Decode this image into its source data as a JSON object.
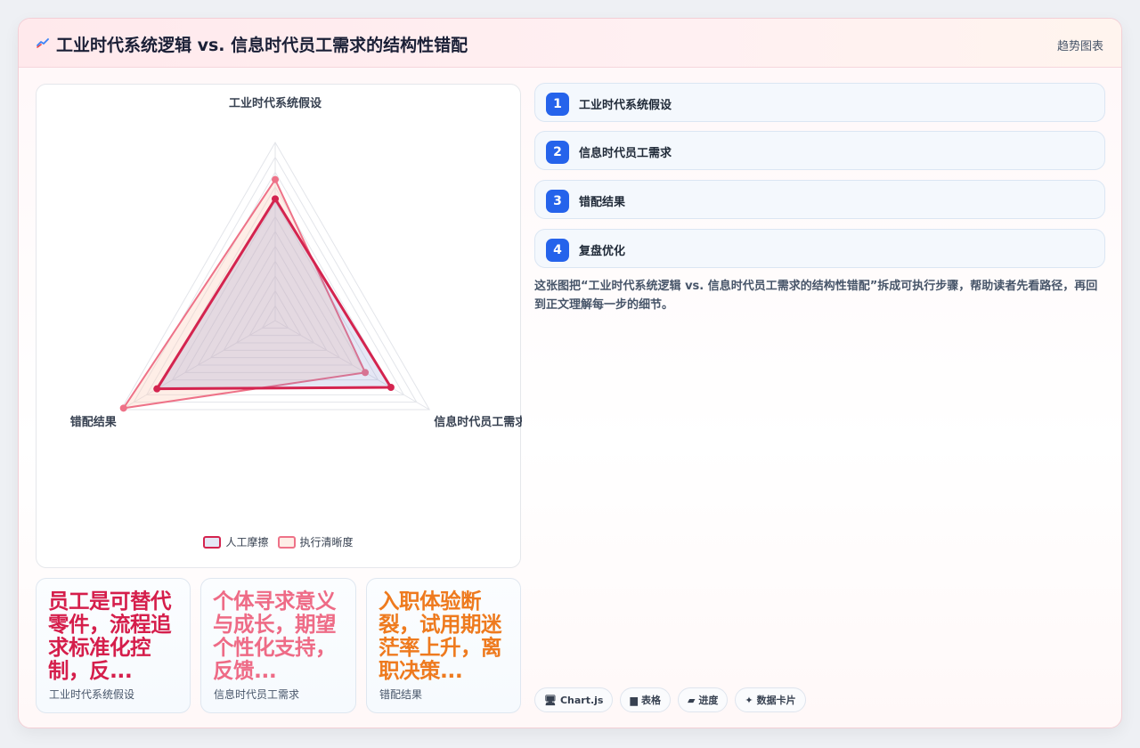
{
  "header": {
    "title": "工业时代系统逻辑 vs. 信息时代员工需求的结构性错配",
    "link": "趋势图表",
    "icon": "trend-icon"
  },
  "chart_data": {
    "type": "radar",
    "categories": [
      "工业时代系统假设",
      "信息时代员工需求",
      "错配结果"
    ],
    "series": [
      {
        "name": "人工摩擦",
        "color": "#d4244f",
        "fill": "rgba(110,120,200,0.18)",
        "values": [
          82,
          90,
          92
        ]
      },
      {
        "name": "执行清晰度",
        "color": "#ee7288",
        "fill": "rgba(252,205,185,0.35)",
        "values": [
          95,
          70,
          118
        ]
      }
    ],
    "rlim": [
      0,
      120
    ],
    "grid_rings": 12
  },
  "stats": [
    {
      "value": "员工是可替代零件，流程追求标准化控制，反...",
      "label": "工业时代系统假设",
      "color": "#d51e4b"
    },
    {
      "value": "个体寻求意义与成长，期望个性化支持，反馈...",
      "label": "信息时代员工需求",
      "color": "#ee6b86"
    },
    {
      "value": "入职体验断裂，试用期迷茫率上升，离职决策...",
      "label": "错配结果",
      "color": "#ee7a1e"
    }
  ],
  "steps": [
    {
      "num": "1",
      "label": "工业时代系统假设"
    },
    {
      "num": "2",
      "label": "信息时代员工需求"
    },
    {
      "num": "3",
      "label": "错配结果"
    },
    {
      "num": "4",
      "label": "复盘优化"
    }
  ],
  "description": "这张图把“工业时代系统逻辑 vs. 信息时代员工需求的结构性错配”拆成可执行步骤，帮助读者先看路径，再回到正文理解每一步的细节。",
  "tags": [
    {
      "icon": "🖥",
      "label": "Chart.js"
    },
    {
      "icon": "▆",
      "label": "表格"
    },
    {
      "icon": "▰",
      "label": "进度"
    },
    {
      "icon": "✦",
      "label": "数据卡片"
    }
  ]
}
